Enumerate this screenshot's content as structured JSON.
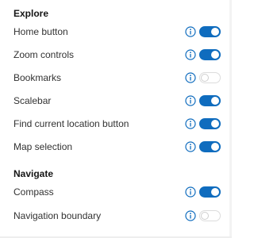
{
  "colors": {
    "accent": "#0f6cbe",
    "toggle_off_border": "#dcdcdc",
    "text": "#323232",
    "heading": "#151515"
  },
  "sections": [
    {
      "title": "Explore",
      "items": [
        {
          "label": "Home button",
          "enabled": true,
          "icon": "info-icon"
        },
        {
          "label": "Zoom controls",
          "enabled": true,
          "icon": "info-icon"
        },
        {
          "label": "Bookmarks",
          "enabled": false,
          "icon": "info-icon"
        },
        {
          "label": "Scalebar",
          "enabled": true,
          "icon": "info-icon"
        },
        {
          "label": "Find current location button",
          "enabled": true,
          "icon": "info-icon"
        },
        {
          "label": "Map selection",
          "enabled": true,
          "icon": "info-icon"
        }
      ]
    },
    {
      "title": "Navigate",
      "items": [
        {
          "label": "Compass",
          "enabled": true,
          "icon": "info-icon"
        },
        {
          "label": "Navigation boundary",
          "enabled": false,
          "icon": "info-icon"
        }
      ]
    }
  ]
}
